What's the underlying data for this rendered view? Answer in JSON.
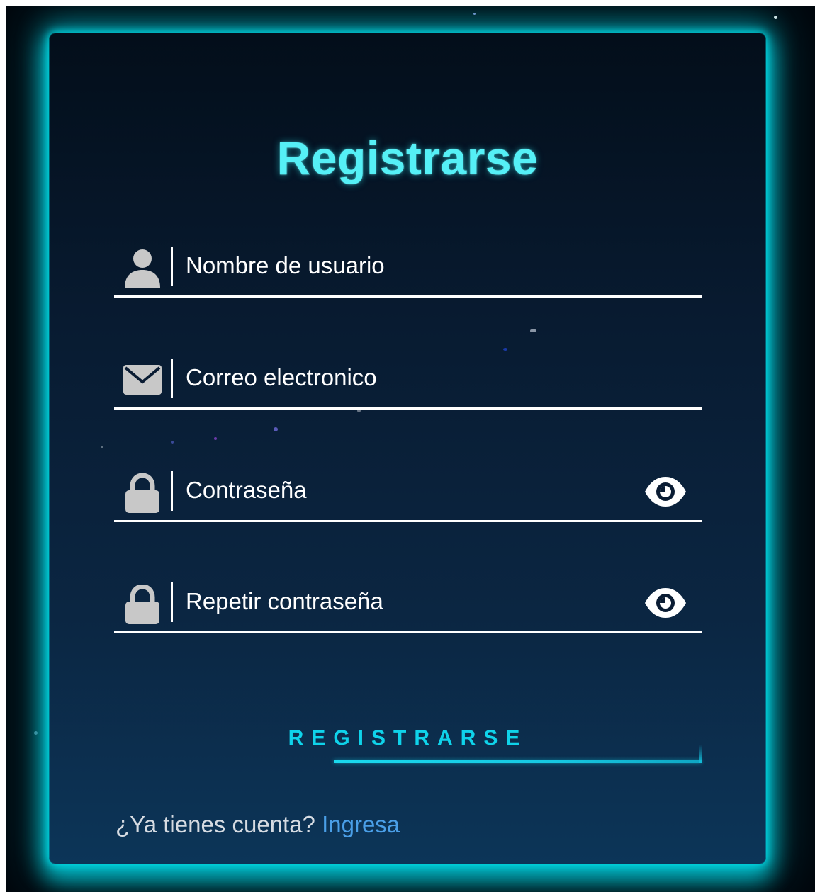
{
  "form": {
    "title": "Registrarse",
    "fields": [
      {
        "icon": "user-icon",
        "placeholder": "Nombre de usuario",
        "type": "text"
      },
      {
        "icon": "envelope-icon",
        "placeholder": "Correo electronico",
        "type": "email"
      },
      {
        "icon": "lock-icon",
        "placeholder": "Contraseña",
        "type": "password",
        "toggle_icon": "eye-icon"
      },
      {
        "icon": "lock-icon",
        "placeholder": "Repetir contraseña",
        "type": "password",
        "toggle_icon": "eye-icon"
      }
    ],
    "submit_label": "REGISTRARSE",
    "login_prompt": "¿Ya tienes cuenta?",
    "login_link": "Ingresa"
  },
  "colors": {
    "title": "#55f0f6",
    "accent": "#0fd3ea",
    "link": "#4a9fe8",
    "glow": "#00e6f0",
    "card_top": "#030e1a",
    "card_bottom": "#0c3558",
    "icon_gray": "#c8c8c8"
  }
}
